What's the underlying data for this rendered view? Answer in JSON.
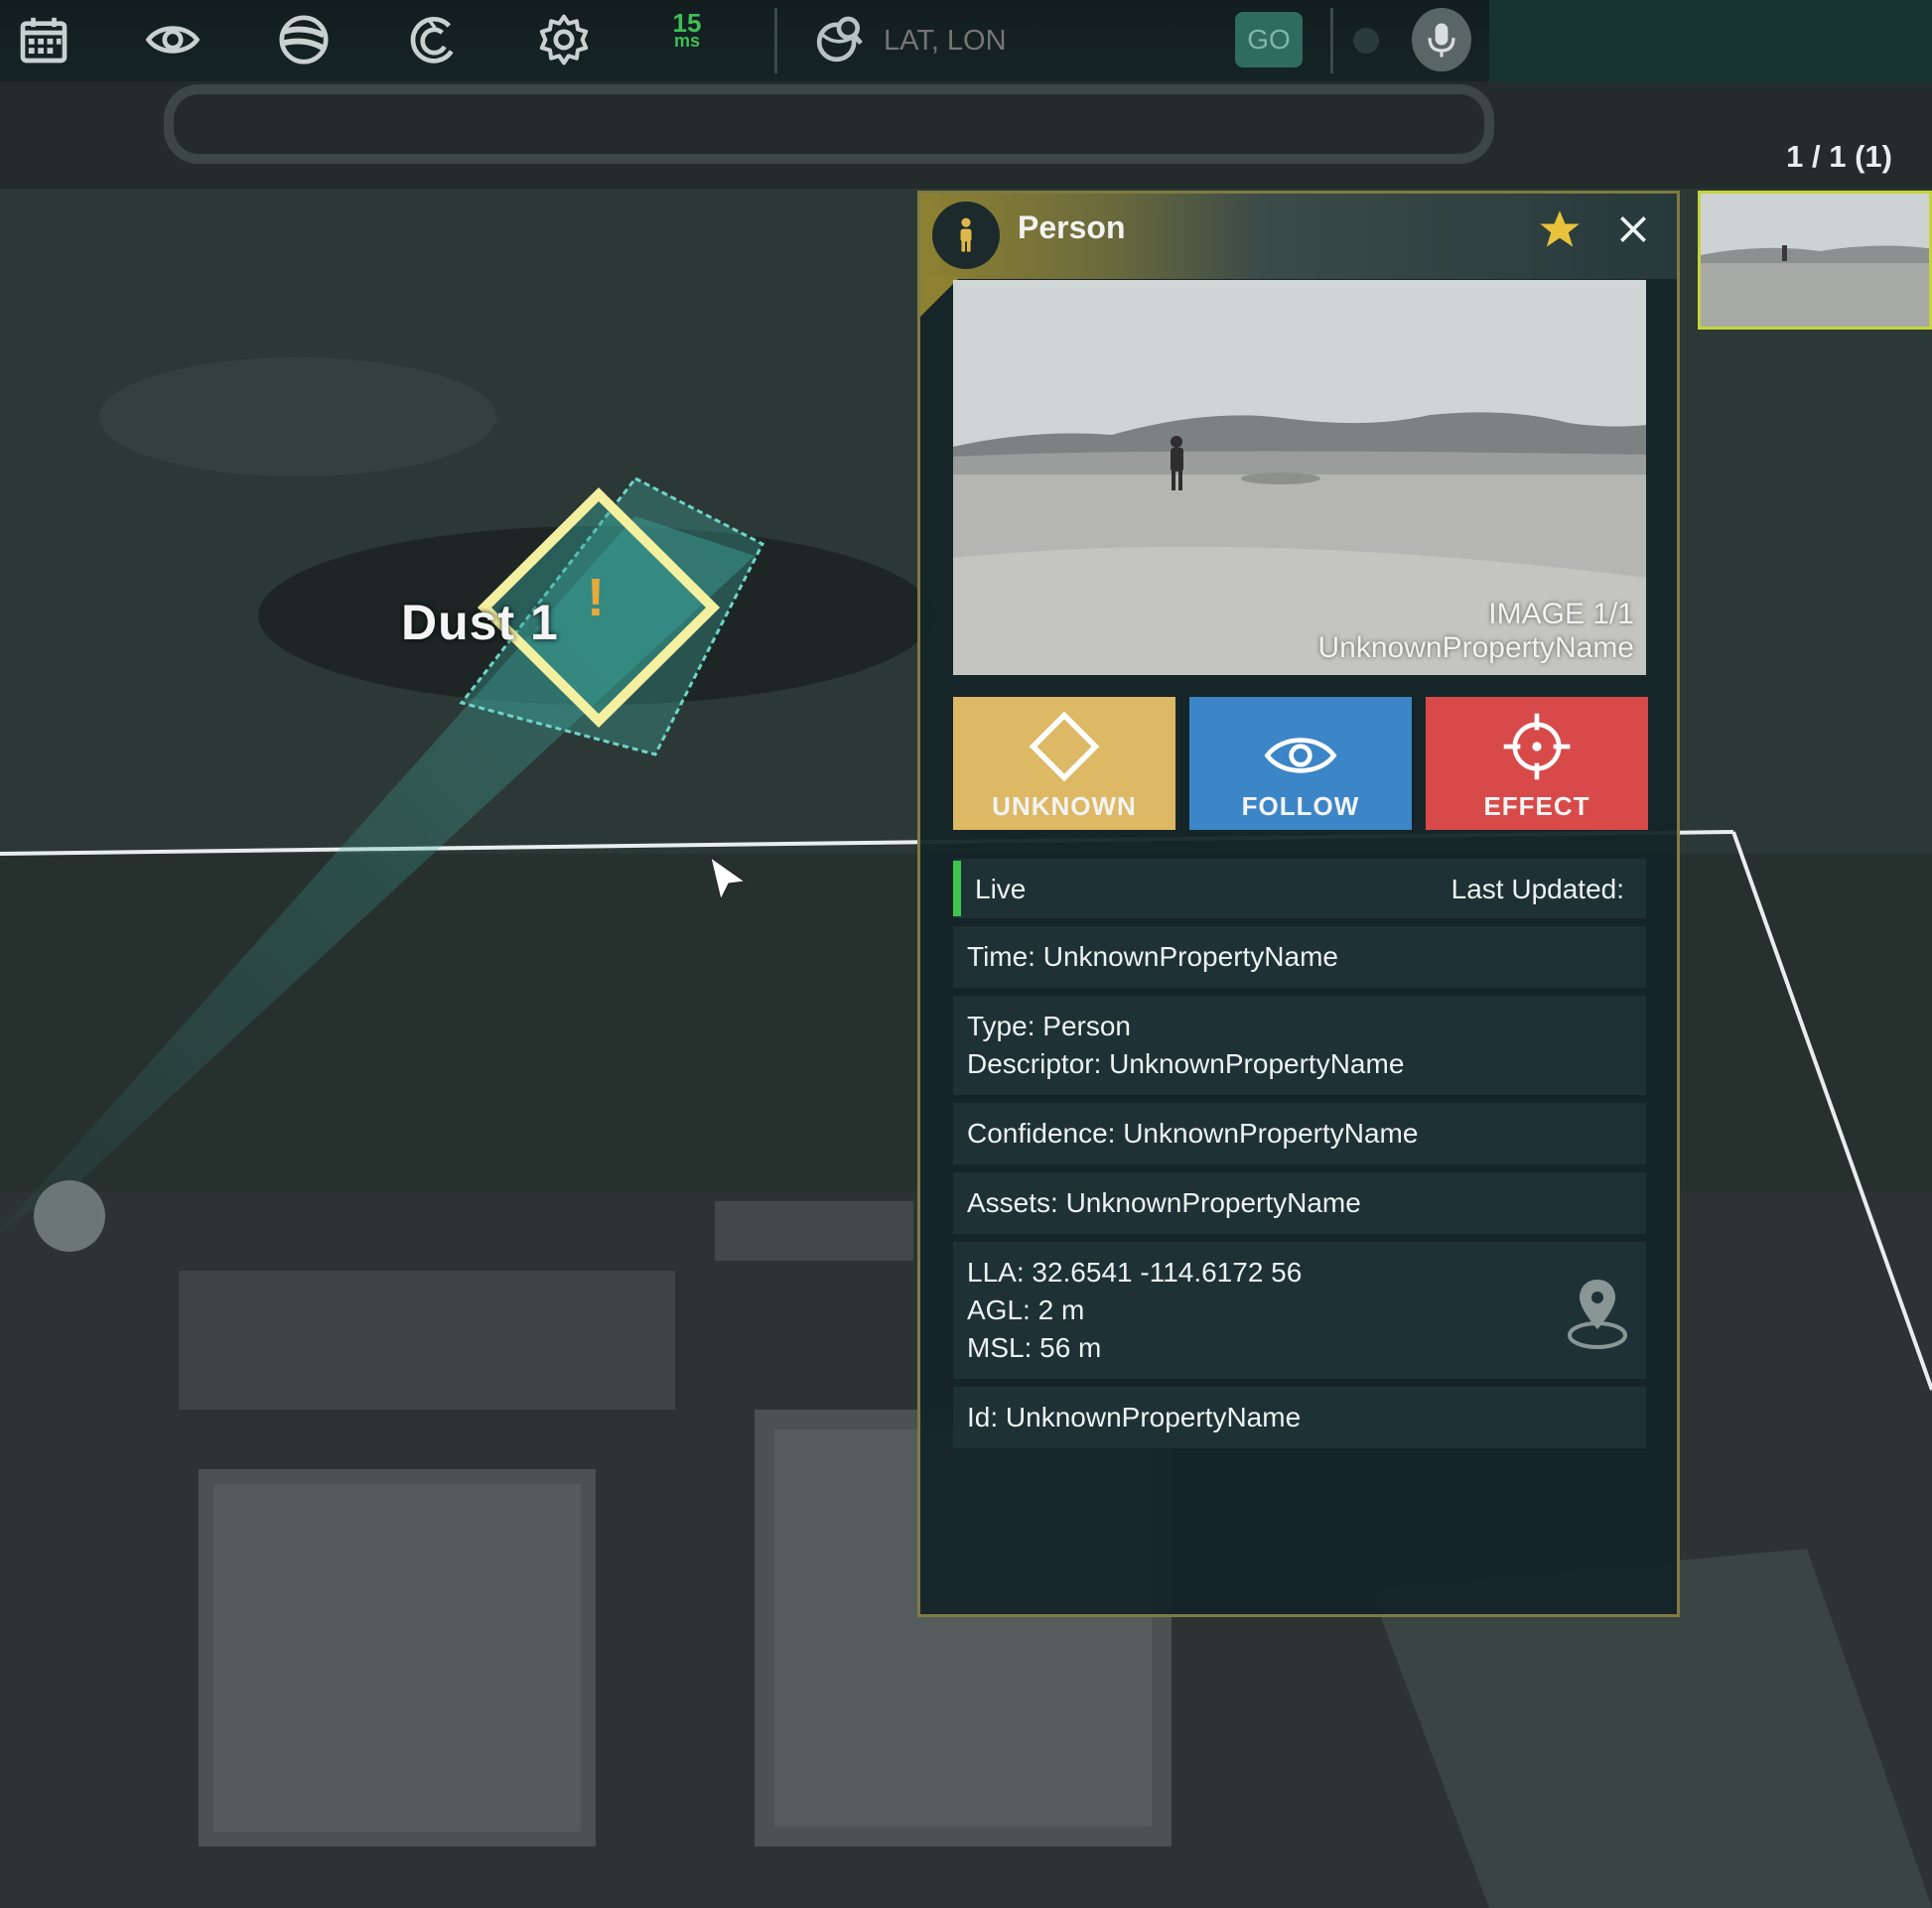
{
  "toolbar": {
    "icons": [
      "calendar-icon",
      "eye-icon",
      "globe-icon",
      "c-logo-icon",
      "gear-icon"
    ],
    "latency_value": "15",
    "latency_unit": "ms",
    "coord_placeholder": "LAT, LON",
    "go_label": "GO",
    "mic_icon": "microphone-icon"
  },
  "map": {
    "counter": "1 / 1 (1)",
    "track_label": "Dust 1"
  },
  "panel": {
    "title": "Person",
    "image_caption_1": "IMAGE 1/1",
    "image_caption_2": "UnknownPropertyName",
    "actions": {
      "unknown": "UNKNOWN",
      "follow": "FOLLOW",
      "effect": "EFFECT"
    },
    "status": "Live",
    "last_updated": "Last Updated:",
    "time": "Time: UnknownPropertyName",
    "type": "Type: Person",
    "descriptor": "Descriptor: UnknownPropertyName",
    "confidence": "Confidence: UnknownPropertyName",
    "assets": "Assets: UnknownPropertyName",
    "lla": "LLA: 32.6541 -114.6172 56",
    "agl": "AGL: 2 m",
    "msl": "MSL: 56 m",
    "id": "Id: UnknownPropertyName"
  },
  "colors": {
    "unknown": "#ddb865",
    "follow": "#3c86c7",
    "effect": "#d84a4a",
    "live": "#3fc64e",
    "latency": "#3fbf55"
  }
}
